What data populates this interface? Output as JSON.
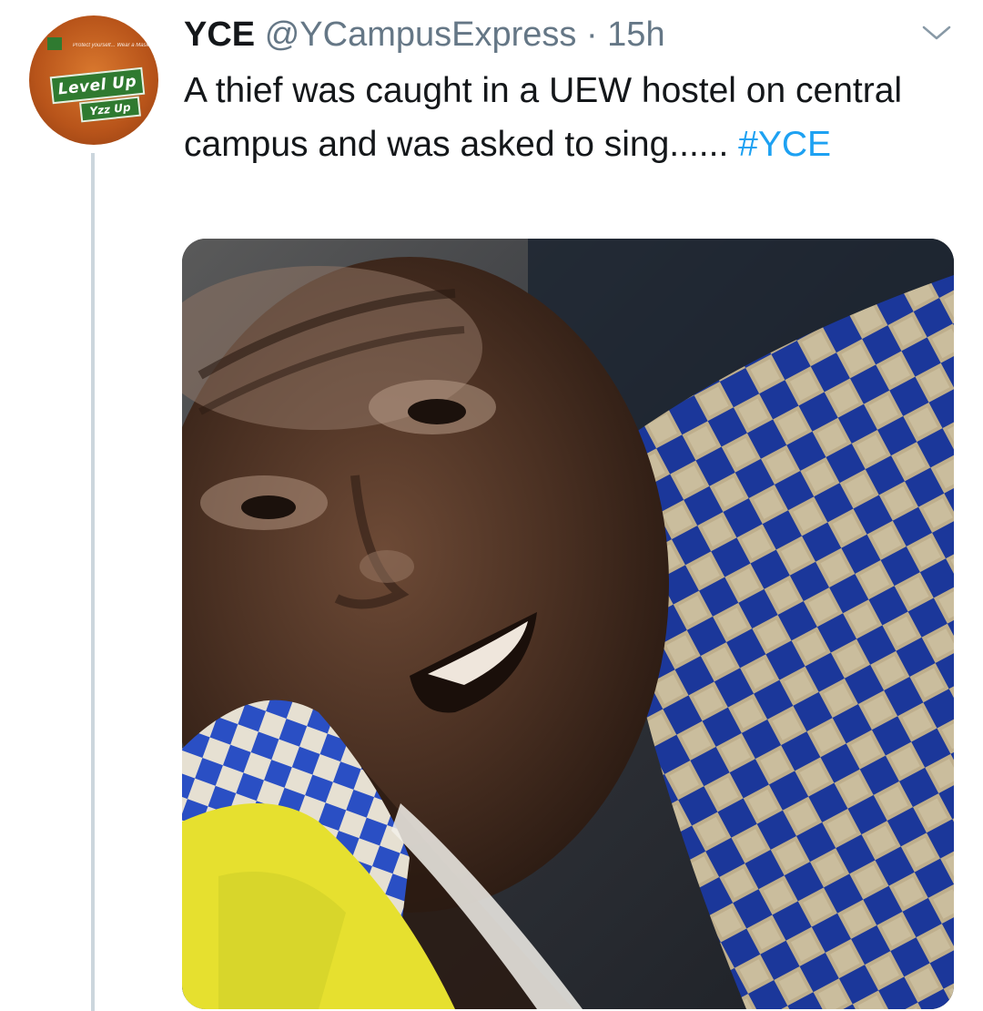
{
  "tweet": {
    "display_name": "YCE",
    "handle": "@YCampusExpress",
    "separator": " · ",
    "time": "15h",
    "text_main": "A thief was caught in a UEW hostel on central campus and was asked  to sing......  ",
    "hashtag": "#YCE"
  },
  "avatar": {
    "tagline": "Protect yourself... Wear a Mask!",
    "line1": "Level Up",
    "line2": "Yzz Up"
  },
  "icons": {
    "menu": "chevron-down-icon"
  },
  "colors": {
    "hashtag": "#1da1f2",
    "meta_text": "#657786",
    "thread_line": "#ccd6dd",
    "avatar_green": "#2f7a30",
    "avatar_orange": "#c45f22"
  }
}
